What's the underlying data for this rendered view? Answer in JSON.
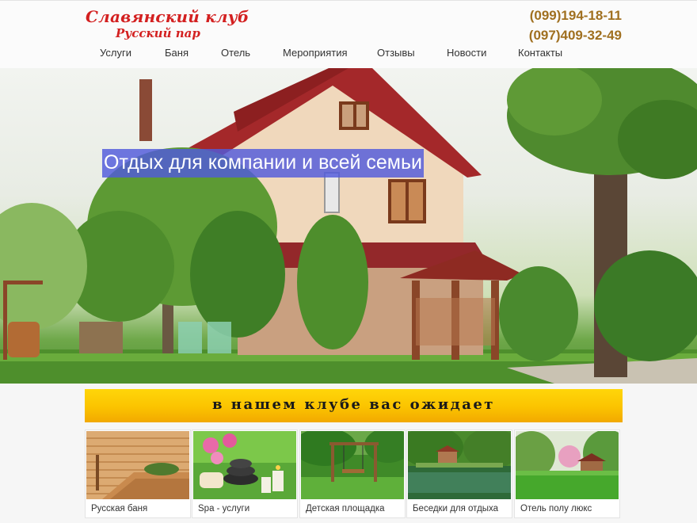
{
  "header": {
    "logo_title": "Славянский клуб",
    "logo_subtitle": "Русский пар",
    "phone1": "(099)194-18-11",
    "phone2": "(097)409-32-49"
  },
  "nav": {
    "items": [
      "Услуги",
      "Баня",
      "Отель",
      "Мероприятия",
      "Отзывы",
      "Новости",
      "Контакты"
    ]
  },
  "hero": {
    "caption": "Отдых для компании и всей семьи"
  },
  "banner": {
    "title": "в нашем клубе вас ожидает"
  },
  "cards": [
    {
      "label": "Русская баня"
    },
    {
      "label": "Spa - услуги"
    },
    {
      "label": "Детская площадка"
    },
    {
      "label": "Беседки для отдыха"
    },
    {
      "label": "Отель полу люкс"
    }
  ],
  "colors": {
    "logo_red": "#d32020",
    "phone_gold": "#a07020",
    "banner_yellow": "#fbc300",
    "caption_blue": "#505adc"
  }
}
